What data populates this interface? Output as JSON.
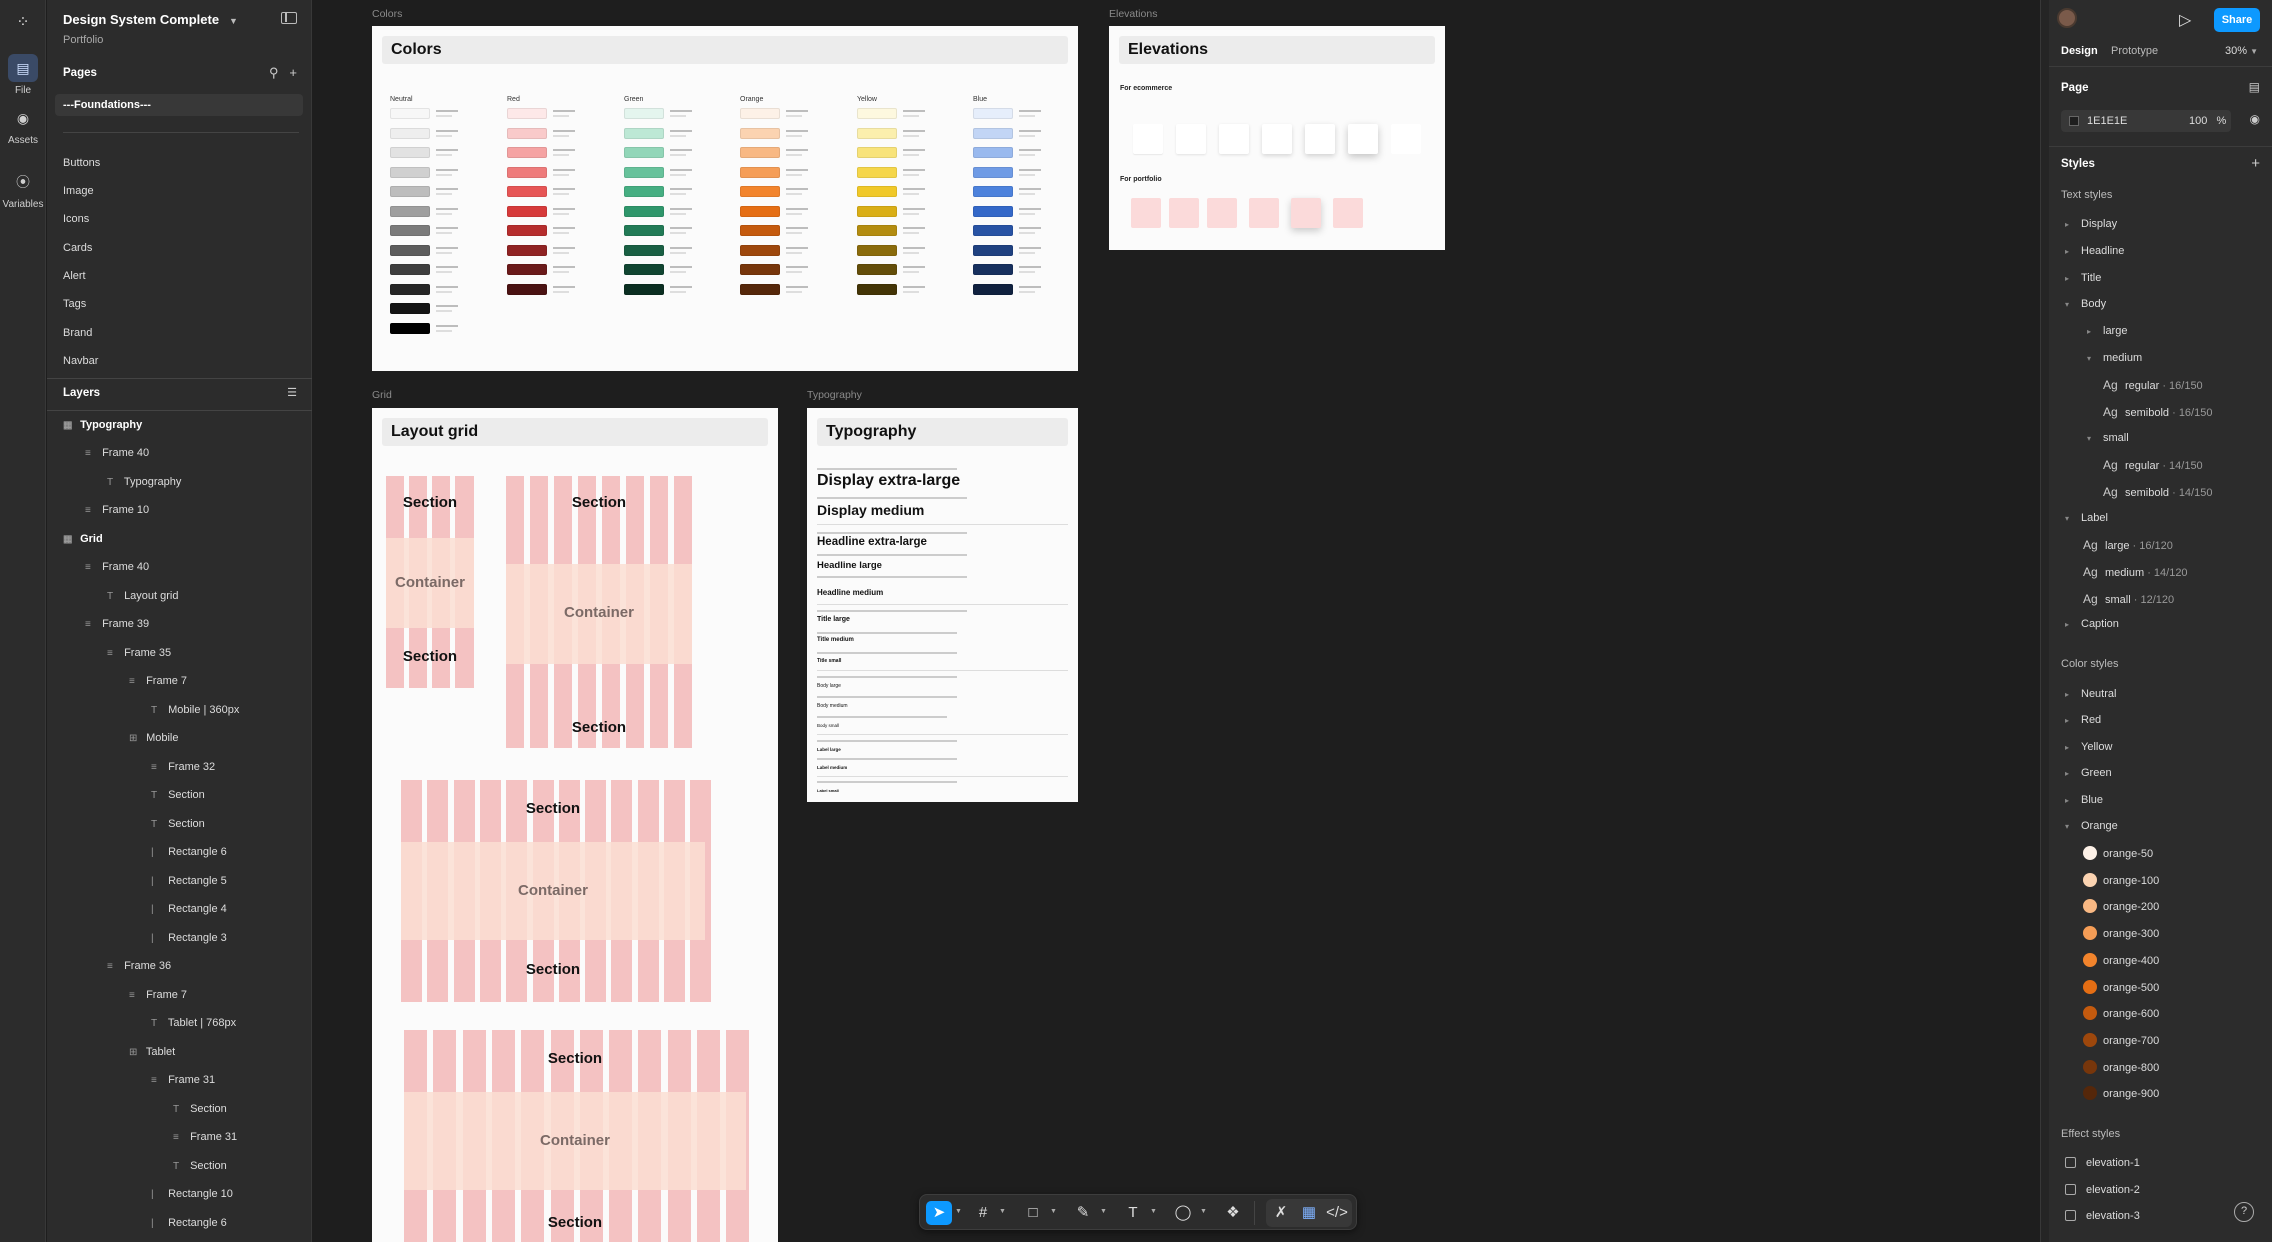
{
  "rail": {
    "file": "File",
    "assets": "Assets",
    "variables": "Variables"
  },
  "file": {
    "title": "Design System Complete",
    "project": "Portfolio"
  },
  "pages": {
    "heading": "Pages",
    "items": [
      "---Foundations---",
      "Buttons",
      "Image",
      "Icons",
      "Cards",
      "Alert",
      "Tags",
      "Brand",
      "Navbar"
    ]
  },
  "layers": {
    "heading": "Layers",
    "items": [
      "Typography",
      "Frame 40",
      "Typography",
      "Frame 10",
      "Grid",
      "Frame 40",
      "Layout grid",
      "Frame 39",
      "Frame 35",
      "Frame 7",
      "Mobile | 360px",
      "Mobile",
      "Frame 32",
      "Section",
      "Section",
      "Rectangle 6",
      "Rectangle 5",
      "Rectangle 4",
      "Rectangle 3",
      "Frame 36",
      "Frame 7",
      "Tablet | 768px",
      "Tablet",
      "Frame 31",
      "Section",
      "Frame 31",
      "Section",
      "Rectangle 10",
      "Rectangle 6"
    ]
  },
  "canvas": {
    "colors_label": "Colors",
    "colors_title": "Colors",
    "color_columns": [
      "Neutral",
      "Red",
      "Green",
      "Orange",
      "Yellow",
      "Blue"
    ],
    "elevations_label": "Elevations",
    "elevations_title": "Elevations",
    "for_ecommerce": "For ecommerce",
    "for_portfolio": "For portfolio",
    "grid_label": "Grid",
    "grid_title": "Layout grid",
    "section": "Section",
    "container": "Container",
    "typography_label": "Typography",
    "typography_title": "Typography",
    "typo_samples": [
      "Display extra-large",
      "Display medium",
      "Headline extra-large",
      "Headline large",
      "Headline medium",
      "Title large",
      "Title medium",
      "Title small",
      "Body large",
      "Body medium",
      "Body small",
      "Label large",
      "Label medium",
      "Label small"
    ]
  },
  "right": {
    "share": "Share",
    "tab_design": "Design",
    "tab_prototype": "Prototype",
    "zoom": "30%",
    "page_heading": "Page",
    "page_color": "1E1E1E",
    "page_opacity": "100",
    "page_pct": "%",
    "styles_heading": "Styles",
    "text_styles": "Text styles",
    "text_groups": [
      "Display",
      "Headline",
      "Title",
      "Body"
    ],
    "body_large": "large",
    "body_medium": "medium",
    "body_medium_regular": "regular",
    "body_medium_regular_meta": "· 16/150",
    "body_medium_semibold": "semibold",
    "body_medium_semibold_meta": "· 16/150",
    "body_small": "small",
    "body_small_regular": "regular",
    "body_small_regular_meta": "· 14/150",
    "body_small_semibold": "semibold",
    "body_small_semibold_meta": "· 14/150",
    "label": "Label",
    "label_large": "large",
    "label_large_meta": "· 16/120",
    "label_medium": "medium",
    "label_medium_meta": "· 14/120",
    "label_small": "small",
    "label_small_meta": "· 12/120",
    "caption": "Caption",
    "ag": "Ag",
    "color_styles": "Color styles",
    "color_groups": [
      "Neutral",
      "Red",
      "Yellow",
      "Green",
      "Blue",
      "Orange"
    ],
    "orange_swatches": [
      {
        "name": "orange-50",
        "color": "#fdf1e7"
      },
      {
        "name": "orange-100",
        "color": "#fbd3b1"
      },
      {
        "name": "orange-200",
        "color": "#f8b883"
      },
      {
        "name": "orange-300",
        "color": "#f59d56"
      },
      {
        "name": "orange-400",
        "color": "#f2842c"
      },
      {
        "name": "orange-500",
        "color": "#e56e14"
      },
      {
        "name": "orange-600",
        "color": "#c45a0e"
      },
      {
        "name": "orange-700",
        "color": "#9d470c"
      },
      {
        "name": "orange-800",
        "color": "#77360b"
      },
      {
        "name": "orange-900",
        "color": "#55270a"
      }
    ],
    "effect_styles": "Effect styles",
    "effects": [
      "elevation-1",
      "elevation-2",
      "elevation-3"
    ]
  },
  "colors": {
    "accent": "#0d99ff",
    "grid_pink": "#f4c2c2",
    "grid_band": "#fadfd2"
  }
}
